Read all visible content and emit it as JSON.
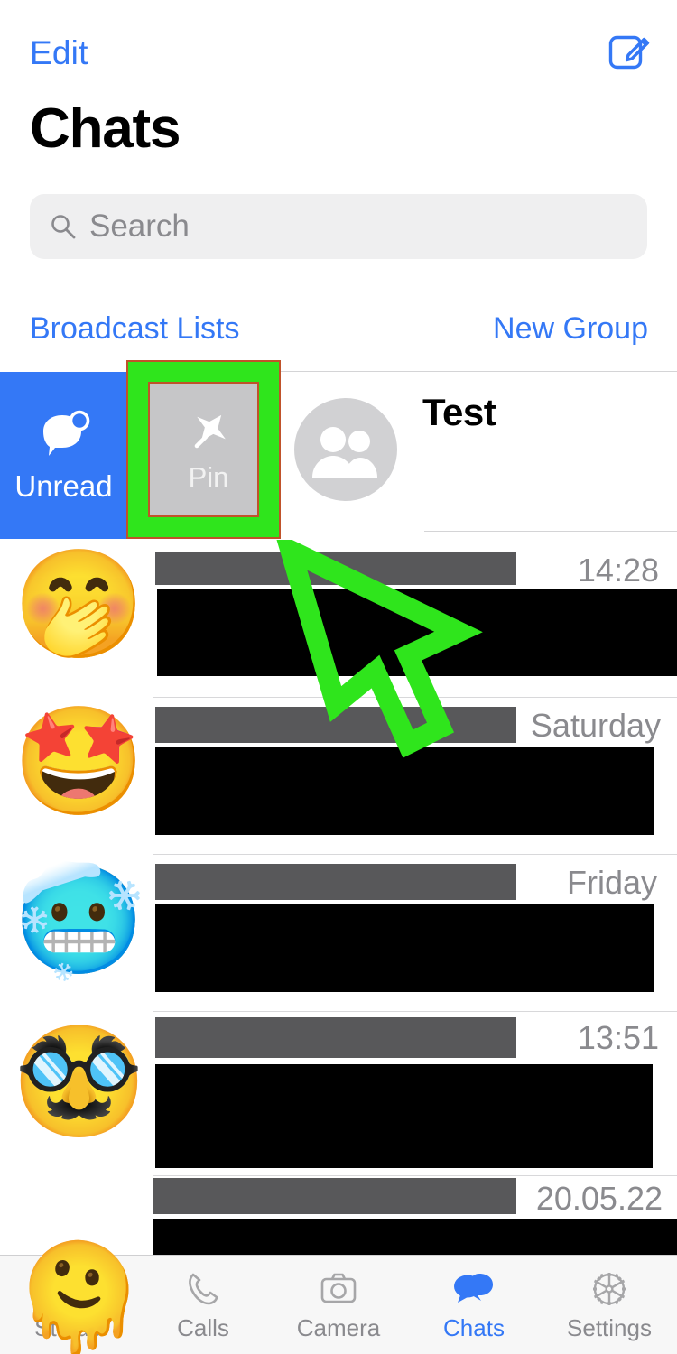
{
  "nav": {
    "edit_label": "Edit",
    "compose_icon": "compose-icon",
    "title": "Chats"
  },
  "search": {
    "placeholder": "Search",
    "value": "",
    "icon": "search-icon"
  },
  "links": {
    "broadcast_label": "Broadcast Lists",
    "new_group_label": "New Group"
  },
  "swipe_row": {
    "chat_title": "Test",
    "avatar_icon": "group-avatar-icon",
    "actions": [
      {
        "label": "Unread",
        "icon": "unread-bubble-icon",
        "color": "#3478F6"
      },
      {
        "label": "Pin",
        "icon": "pin-icon",
        "color": "#C6C6C8"
      }
    ],
    "highlight_color": "#2FE51C",
    "highlight_outline_color": "#C0522A"
  },
  "chat_list": [
    {
      "avatar": "🤭",
      "time": "14:28",
      "title_redacted": true,
      "message_redacted": true
    },
    {
      "avatar": "🤩",
      "time": "Saturday",
      "title_redacted": true,
      "message_redacted": true
    },
    {
      "avatar": "🥶",
      "time": "Friday",
      "title_redacted": true,
      "message_redacted": true
    },
    {
      "avatar": "🥸",
      "time": "13:51",
      "title_redacted": true,
      "message_redacted": true
    },
    {
      "avatar": "🫠",
      "time": "20.05.22",
      "title_redacted": true,
      "message_redacted": true
    }
  ],
  "cursor": {
    "color": "#2FE51C",
    "outline": "#C0522A",
    "shape": "arrow-pointer"
  },
  "tab_bar": {
    "items": [
      {
        "label": "Status",
        "icon": "status-rings-icon",
        "active": false
      },
      {
        "label": "Calls",
        "icon": "phone-icon",
        "active": false
      },
      {
        "label": "Camera",
        "icon": "camera-icon",
        "active": false
      },
      {
        "label": "Chats",
        "icon": "chats-bubbles-icon",
        "active": true
      },
      {
        "label": "Settings",
        "icon": "gear-icon",
        "active": false
      }
    ],
    "active_color": "#3478F6",
    "inactive_color": "#8A8A8E"
  }
}
